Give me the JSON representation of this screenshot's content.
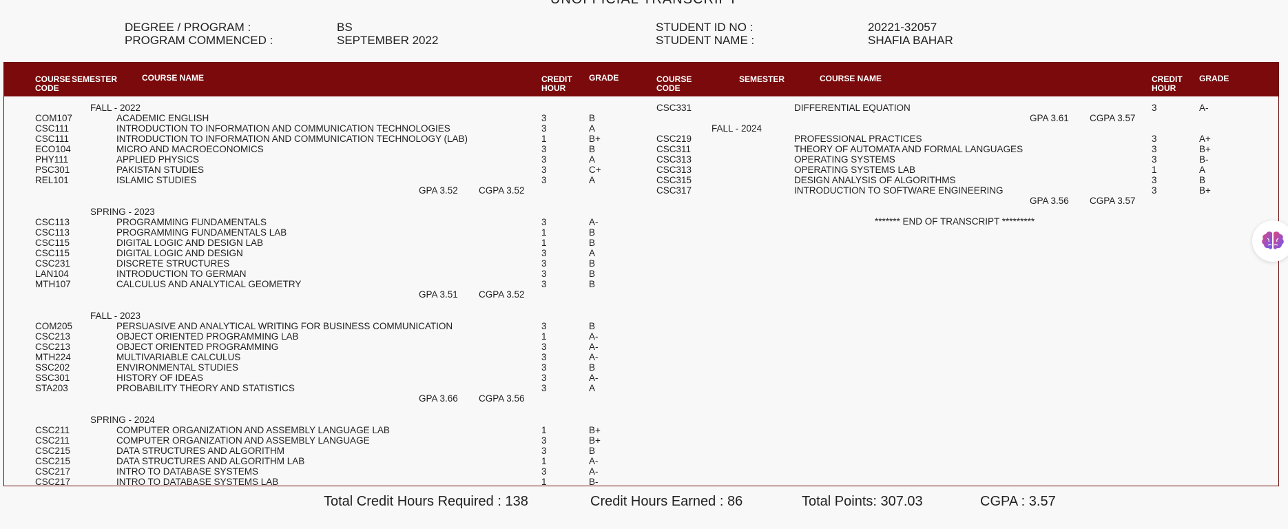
{
  "title": "UNOFFICIAL TRANSCRIPT",
  "header": {
    "degree_label": "DEGREE / PROGRAM :",
    "degree_value": "BS",
    "commenced_label": "PROGRAM COMMENCED :",
    "commenced_value": "SEPTEMBER 2022",
    "student_id_label": "STUDENT ID NO :",
    "student_id_value": "20221-32057",
    "student_name_label": "STUDENT NAME :",
    "student_name_value": "SHAFIA BAHAR"
  },
  "columns": {
    "course_code": "COURSE CODE",
    "course_code_l1": "COURSE",
    "course_code_l2": "CODE",
    "semester": "SEMESTER",
    "course_name": "COURSE NAME",
    "credit_l1": "CREDIT",
    "credit_l2": "HOUR",
    "grade": "GRADE"
  },
  "terms": [
    {
      "name": "FALL - 2022",
      "courses": [
        {
          "code": "COM107",
          "name": "ACADEMIC ENGLISH",
          "credit": "3",
          "grade": "B"
        },
        {
          "code": "CSC111",
          "name": "INTRODUCTION TO INFORMATION AND COMMUNICATION TECHNOLOGIES",
          "credit": "3",
          "grade": "A"
        },
        {
          "code": "CSC111",
          "name": "INTRODUCTION TO INFORMATION AND COMMUNICATION TECHNOLOGY (LAB)",
          "credit": "1",
          "grade": "B+"
        },
        {
          "code": "ECO104",
          "name": "MICRO AND MACROECONOMICS",
          "credit": "3",
          "grade": "B"
        },
        {
          "code": "PHY111",
          "name": "APPLIED PHYSICS",
          "credit": "3",
          "grade": "A"
        },
        {
          "code": "PSC301",
          "name": "PAKISTAN STUDIES",
          "credit": "3",
          "grade": "C+"
        },
        {
          "code": "REL101",
          "name": "ISLAMIC STUDIES",
          "credit": "3",
          "grade": "A"
        }
      ],
      "gpa": "GPA 3.52",
      "cgpa": "CGPA 3.52"
    },
    {
      "name": "SPRING - 2023",
      "courses": [
        {
          "code": "CSC113",
          "name": "PROGRAMMING FUNDAMENTALS",
          "credit": "3",
          "grade": "A-"
        },
        {
          "code": "CSC113",
          "name": "PROGRAMMING FUNDAMENTALS LAB",
          "credit": "1",
          "grade": "B"
        },
        {
          "code": "CSC115",
          "name": "DIGITAL LOGIC AND DESIGN LAB",
          "credit": "1",
          "grade": "B"
        },
        {
          "code": "CSC115",
          "name": "DIGITAL LOGIC AND DESIGN",
          "credit": "3",
          "grade": "A"
        },
        {
          "code": "CSC231",
          "name": "DISCRETE STRUCTURES",
          "credit": "3",
          "grade": "B"
        },
        {
          "code": "LAN104",
          "name": "INTRODUCTION TO GERMAN",
          "credit": "3",
          "grade": "B"
        },
        {
          "code": "MTH107",
          "name": "CALCULUS AND ANALYTICAL GEOMETRY",
          "credit": "3",
          "grade": "B"
        }
      ],
      "gpa": "GPA 3.51",
      "cgpa": "CGPA 3.52"
    },
    {
      "name": "FALL - 2023",
      "courses": [
        {
          "code": "COM205",
          "name": "PERSUASIVE AND ANALYTICAL WRITING FOR BUSINESS COMMUNICATION",
          "credit": "3",
          "grade": "B"
        },
        {
          "code": "CSC213",
          "name": "OBJECT ORIENTED PROGRAMMING LAB",
          "credit": "1",
          "grade": "A-"
        },
        {
          "code": "CSC213",
          "name": "OBJECT ORIENTED PROGRAMMING",
          "credit": "3",
          "grade": "A-"
        },
        {
          "code": "MTH224",
          "name": "MULTIVARIABLE CALCULUS",
          "credit": "3",
          "grade": "A-"
        },
        {
          "code": "SSC202",
          "name": "ENVIRONMENTAL STUDIES",
          "credit": "3",
          "grade": "B"
        },
        {
          "code": "SSC301",
          "name": "HISTORY OF IDEAS",
          "credit": "3",
          "grade": "A-"
        },
        {
          "code": "STA203",
          "name": "PROBABILITY THEORY AND STATISTICS",
          "credit": "3",
          "grade": "A"
        }
      ],
      "gpa": "GPA 3.66",
      "cgpa": "CGPA 3.56"
    },
    {
      "name": "SPRING - 2024",
      "courses": [
        {
          "code": "CSC211",
          "name": "COMPUTER ORGANIZATION AND ASSEMBLY LANGUAGE LAB",
          "credit": "1",
          "grade": "B+"
        },
        {
          "code": "CSC211",
          "name": "COMPUTER ORGANIZATION AND ASSEMBLY LANGUAGE",
          "credit": "3",
          "grade": "B+"
        },
        {
          "code": "CSC215",
          "name": "DATA STRUCTURES AND ALGORITHM",
          "credit": "3",
          "grade": "B"
        },
        {
          "code": "CSC215",
          "name": "DATA STRUCTURES AND ALGORITHM LAB",
          "credit": "1",
          "grade": "A-"
        },
        {
          "code": "CSC217",
          "name": "INTRO TO DATABASE SYSTEMS",
          "credit": "3",
          "grade": "A-"
        },
        {
          "code": "CSC217",
          "name": "INTRO TO DATABASE SYSTEMS LAB",
          "credit": "1",
          "grade": "B-"
        },
        {
          "code": "CSC331",
          "name": "DIFFERENTIAL EQUATION",
          "credit": "3",
          "grade": "A-"
        }
      ],
      "gpa": "GPA 3.61",
      "cgpa": "CGPA 3.57"
    },
    {
      "name": "FALL - 2024",
      "courses": [
        {
          "code": "CSC219",
          "name": "PROFESSIONAL PRACTICES",
          "credit": "3",
          "grade": "A+"
        },
        {
          "code": "CSC311",
          "name": "THEORY OF AUTOMATA AND FORMAL LANGUAGES",
          "credit": "3",
          "grade": "B+"
        },
        {
          "code": "CSC313",
          "name": "OPERATING SYSTEMS",
          "credit": "3",
          "grade": "B-"
        },
        {
          "code": "CSC313",
          "name": "OPERATING SYSTEMS LAB",
          "credit": "1",
          "grade": "A"
        },
        {
          "code": "CSC315",
          "name": "DESIGN ANALYSIS OF ALGORITHMS",
          "credit": "3",
          "grade": "B"
        },
        {
          "code": "CSC317",
          "name": "INTRODUCTION TO SOFTWARE ENGINEERING",
          "credit": "3",
          "grade": "B+"
        }
      ],
      "gpa": "GPA 3.56",
      "cgpa": "CGPA 3.57"
    }
  ],
  "end_text": "******* END OF TRANSCRIPT *********",
  "footer": {
    "total_required": "Total Credit Hours Required : 138",
    "earned": "Credit Hours Earned : 86",
    "total_points": "Total Points: 307.03",
    "cgpa": "CGPA : 3.57"
  },
  "floating_button_icon": "brain-icon"
}
